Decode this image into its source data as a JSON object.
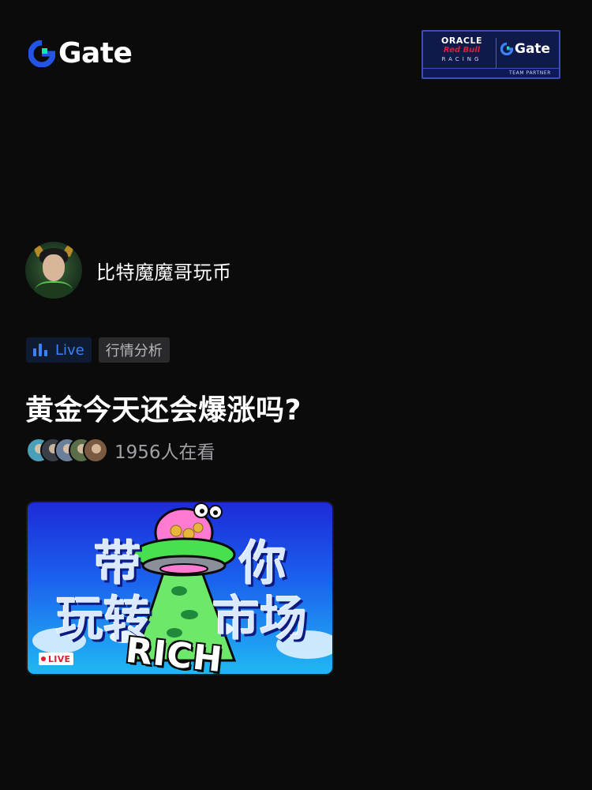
{
  "header": {
    "logo_text": "Gate",
    "partner": {
      "line1": "ORACLE",
      "line2": "Red Bull",
      "line3": "RACING",
      "brand": "Gate",
      "tagline": "TEAM PARTNER"
    }
  },
  "host": {
    "name": "比特魔魔哥玩币"
  },
  "tags": {
    "live_label": "Live",
    "category": "行情分析"
  },
  "stream": {
    "title": "黄金今天还会爆涨吗?",
    "viewer_count": "1956人在看"
  },
  "thumbnail": {
    "text_line1_a": "带",
    "text_line1_b": "你",
    "text_line2_a": "玩转",
    "text_line2_b": "市场",
    "badge": "RICH",
    "live_chip": "LIVE"
  },
  "colors": {
    "background": "#0b0b0c",
    "accent_blue": "#3b82f6",
    "gate_teal": "#17e5a1",
    "live_red": "#e11d2e"
  },
  "icons": {
    "logo": "gate-logo-icon",
    "live": "bar-chart-icon"
  }
}
